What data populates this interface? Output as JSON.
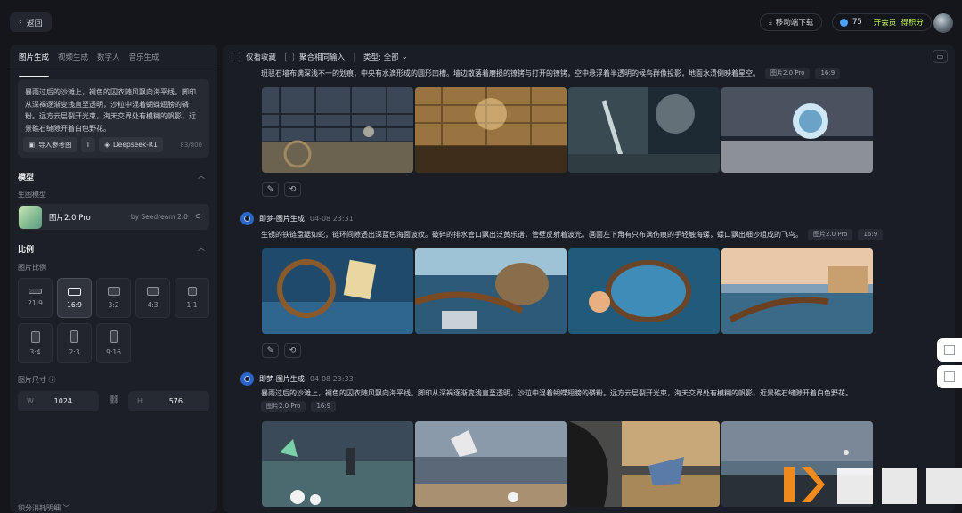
{
  "topbar": {
    "back_label": "返回",
    "mobile_download_label": "移动端下载",
    "credits_value": "75",
    "vip_label": "开会员",
    "points_label": "得积分"
  },
  "left": {
    "tabs": [
      "图片生成",
      "视频生成",
      "数字人",
      "音乐生成"
    ],
    "prompt_text": "暴雨过后的沙滩上，褪色的囚衣随风飘向海平线。脚印从深褐逐渐变浅直至透明，沙粒中混着蝴蝶翅膀的磷粉。远方云层裂开光束，海天交界处有模糊的帆影，近景礁石缝隙开着白色野花。",
    "import_ref_label": "导入参考图",
    "deepseek_label": "Deepseek-R1",
    "char_count": "83/800",
    "model_section": "模型",
    "model_sub": "生图模型",
    "model_name": "图片2.0 Pro",
    "model_by": "by Seedream 2.0",
    "ratio_section": "比例",
    "ratio_sub": "图片比例",
    "ratios": [
      "21:9",
      "16:9",
      "3:2",
      "4:3",
      "1:1",
      "3:4",
      "2:3",
      "9:16"
    ],
    "selected_ratio": "16:9",
    "size_label": "图片尺寸",
    "width_key": "W",
    "width_value": "1024",
    "height_key": "H",
    "height_value": "576",
    "bottom_note": "积分消耗明细"
  },
  "main": {
    "filters": {
      "fav_label": "仅看收藏",
      "aggregate_label": "聚合相同输入",
      "type_label": "类型: 全部"
    },
    "generations": [
      {
        "author": "",
        "time": "",
        "prompt": "斑驳石墙布满深浅不一的划痕，中央有水滴形成的圆形凹槽。墙边散落着磨损的镣铐与打开的镣铐，空中悬浮着半透明的候鸟群像投影，地面水渍倒映着星空。",
        "model_chip": "图片2.0 Pro",
        "ratio_chip": "16:9"
      },
      {
        "author": "即梦-图片生成",
        "time": "04-08  23:31",
        "prompt": "生锈的铁链盘踞如蛇，链环间隙透出深蓝色海面波纹。破碎的排水管口飘出泛黄乐谱，管壁反射着波光。画面左下角有只布满伤痕的手轻触海螺，螺口飘出细沙组成的飞鸟。",
        "model_chip": "图片2.0 Pro",
        "ratio_chip": "16:9"
      },
      {
        "author": "即梦-图片生成",
        "time": "04-08  23:33",
        "prompt": "暴雨过后的沙滩上，褪色的囚衣随风飘向海平线。脚印从深褐逐渐变浅直至透明，沙粒中混着蝴蝶翅膀的磷粉。远方云层裂开光束，海天交界处有模糊的帆影，近景礁石缝隙开着白色野花。",
        "model_chip": "图片2.0 Pro",
        "ratio_chip": "16:9"
      }
    ]
  },
  "colors": {
    "background": "#14161c",
    "panel": "#1c1f26",
    "accent_blue": "#4ea3ff",
    "vip_green": "#c8ff5a"
  },
  "icons": {
    "back": "chevron-left-icon",
    "download": "download-icon",
    "edit": "pencil-icon",
    "regenerate": "refresh-icon",
    "folder": "folder-icon",
    "link": "link-icon",
    "settings": "sliders-icon",
    "info": "info-icon"
  }
}
